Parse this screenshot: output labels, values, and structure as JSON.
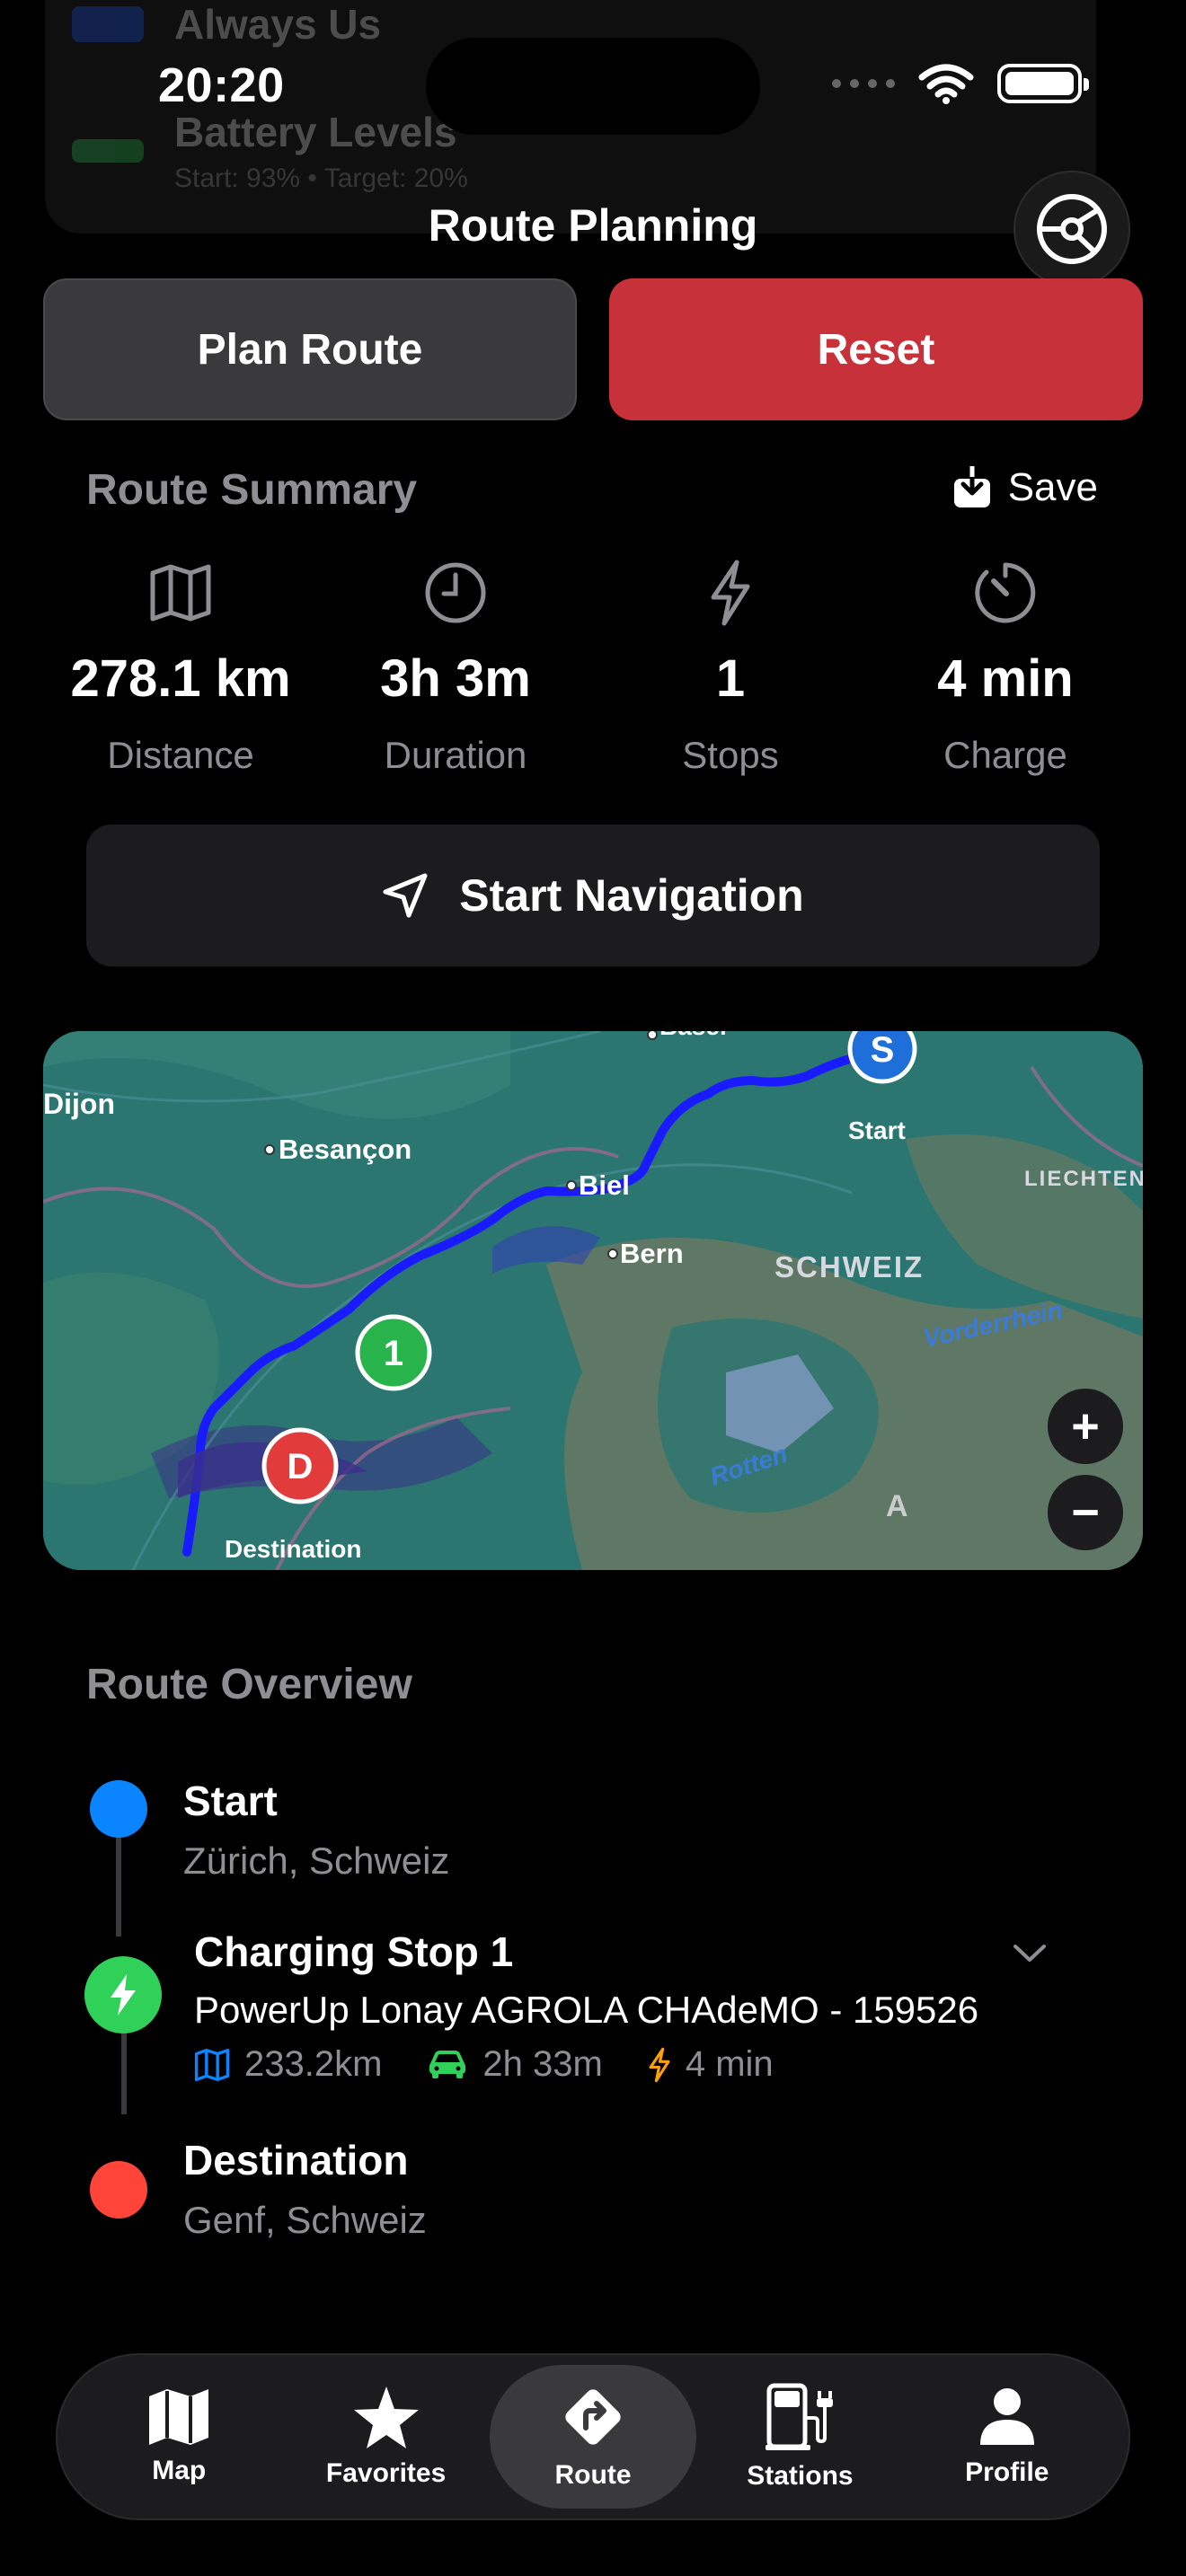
{
  "status": {
    "time": "20:20"
  },
  "ghost": {
    "row1_title": "Always Us",
    "row2_title": "Battery Levels",
    "row2_sub": "Start: 93% • Target: 20%"
  },
  "header": {
    "title": "Route Planning",
    "settings_icon": "steering-wheel-icon"
  },
  "actions": {
    "plan_label": "Plan Route",
    "reset_label": "Reset"
  },
  "summary": {
    "title": "Route Summary",
    "save_label": "Save",
    "stats": [
      {
        "value": "278.1 km",
        "label": "Distance",
        "icon": "map-icon"
      },
      {
        "value": "3h 3m",
        "label": "Duration",
        "icon": "clock-icon"
      },
      {
        "value": "1",
        "label": "Stops",
        "icon": "bolt-icon"
      },
      {
        "value": "4 min",
        "label": "Charge",
        "icon": "timer-icon"
      }
    ]
  },
  "navigation": {
    "label": "Start Navigation"
  },
  "map": {
    "labels": {
      "dijon": "Dijon",
      "besancon": "Besançon",
      "biel": "Biel",
      "bern": "Bern",
      "schweiz": "SCHWEIZ",
      "liechtenstein": "LIECHTEN",
      "vorderrhein": "Vorderrhein",
      "rotten": "Rotten",
      "basel": "Basel",
      "start": "Start",
      "destination": "Destination",
      "a": "A"
    },
    "markers": {
      "start": "S",
      "stop": "1",
      "destination": "D"
    },
    "zoom_in": "+",
    "zoom_out": "−",
    "route_color": "#1a1aff"
  },
  "overview": {
    "title": "Route Overview",
    "start": {
      "title": "Start",
      "subtitle": "Zürich, Schweiz",
      "color": "#0a84ff"
    },
    "stop": {
      "title": "Charging Stop 1",
      "station": "PowerUp Lonay AGROLA CHAdeMO - 159526",
      "distance": "233.2km",
      "drive_time": "2h 33m",
      "charge_time": "4 min",
      "color": "#30d158"
    },
    "destination": {
      "title": "Destination",
      "subtitle": "Genf, Schweiz",
      "color": "#ff453a"
    }
  },
  "tabs": [
    {
      "label": "Map",
      "icon": "map-icon"
    },
    {
      "label": "Favorites",
      "icon": "star-icon"
    },
    {
      "label": "Route",
      "icon": "route-sign-icon",
      "active": true
    },
    {
      "label": "Stations",
      "icon": "fuel-pump-icon"
    },
    {
      "label": "Profile",
      "icon": "person-icon"
    }
  ]
}
